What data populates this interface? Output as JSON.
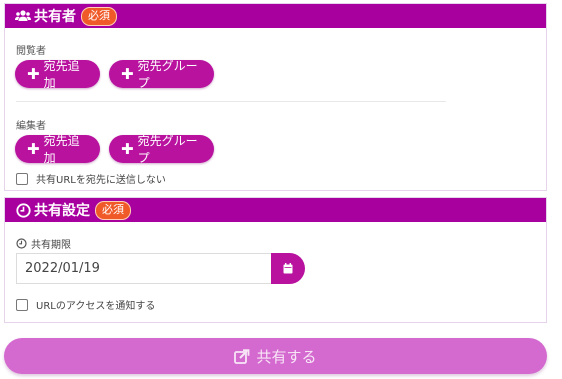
{
  "share": {
    "title": "共有者",
    "required_badge": "必須",
    "viewers": {
      "label": "閲覧者",
      "add_recipient": "宛先追加",
      "recipient_group": "宛先グループ"
    },
    "editors": {
      "label": "編集者",
      "add_recipient": "宛先追加",
      "recipient_group": "宛先グループ"
    },
    "no_send_url_label": "共有URLを宛先に送信しない"
  },
  "settings": {
    "title": "共有設定",
    "required_badge": "必須",
    "expiry_label": "共有期限",
    "expiry_value": "2022/01/19",
    "notify_access_label": "URLのアクセスを通知する"
  },
  "submit": {
    "label": "共有する"
  },
  "icons": {
    "share_header": "users-icon",
    "settings_header": "clock-icon",
    "expiry": "clock-icon",
    "calendar": "calendar-icon",
    "submit": "share-icon"
  },
  "colors": {
    "header_bg": "#a8009f",
    "button_bg": "#b8129f",
    "badge_bg": "#f05a28",
    "submit_bg": "#d46ad0"
  }
}
